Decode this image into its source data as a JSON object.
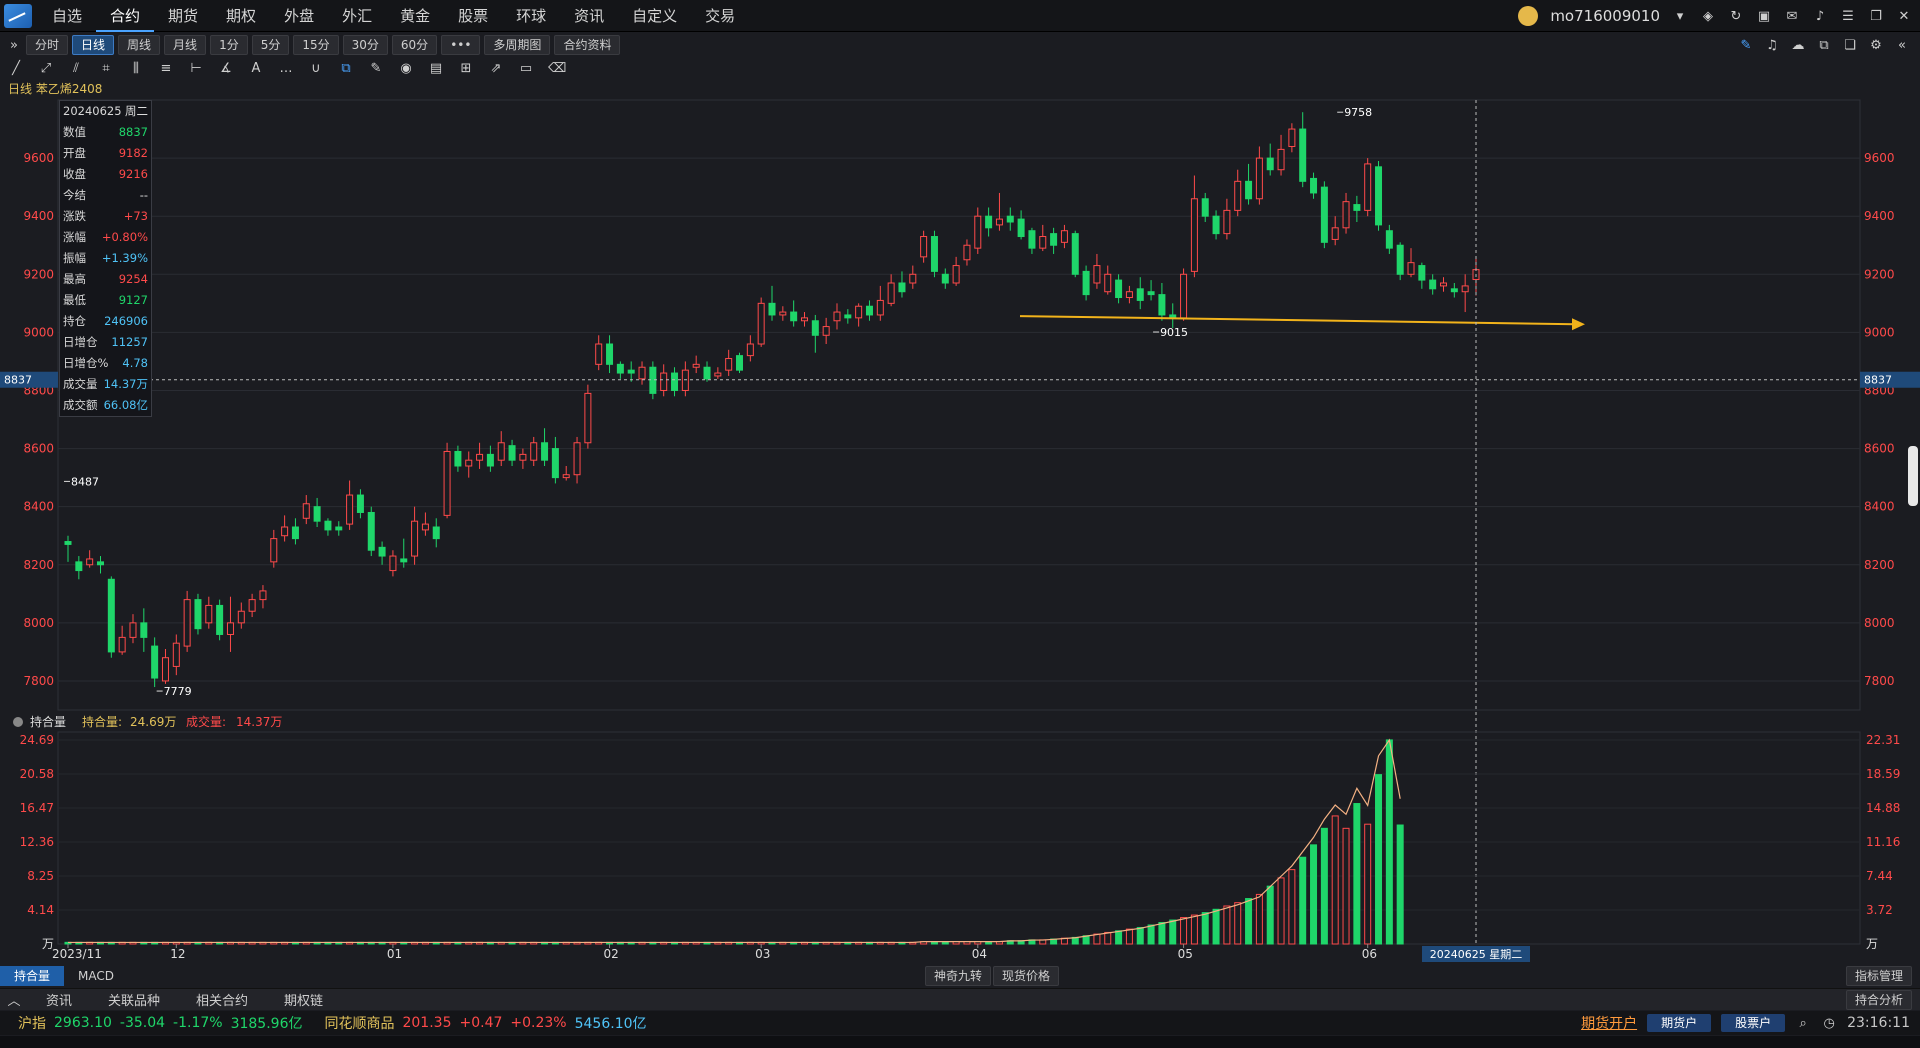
{
  "nav": {
    "items": [
      "自选",
      "合约",
      "期货",
      "期权",
      "外盘",
      "外汇",
      "黄金",
      "股票",
      "环球",
      "资讯",
      "自定义",
      "交易"
    ],
    "active": "合约",
    "user": "mo716009010"
  },
  "periods": {
    "items": [
      "分时",
      "日线",
      "周线",
      "月线",
      "1分",
      "5分",
      "15分",
      "30分",
      "60分",
      "•••",
      "多周期图",
      "合约资料"
    ],
    "active": "日线"
  },
  "title": "日线 苯乙烯2408",
  "info": {
    "rows": [
      {
        "k": "20240625",
        "v": "周二",
        "c": "white"
      },
      {
        "k": "数值",
        "v": "8837",
        "c": "green"
      },
      {
        "k": "开盘",
        "v": "9182",
        "c": "red"
      },
      {
        "k": "收盘",
        "v": "9216",
        "c": "red"
      },
      {
        "k": "今结",
        "v": "--",
        "c": "white"
      },
      {
        "k": "涨跌",
        "v": "+73",
        "c": "red"
      },
      {
        "k": "涨幅",
        "v": "+0.80%",
        "c": "red"
      },
      {
        "k": "振幅",
        "v": "+1.39%",
        "c": "cyan"
      },
      {
        "k": "最高",
        "v": "9254",
        "c": "red"
      },
      {
        "k": "最低",
        "v": "9127",
        "c": "green"
      },
      {
        "k": "持仓",
        "v": "246906",
        "c": "cyan"
      },
      {
        "k": "日增仓",
        "v": "11257",
        "c": "cyan"
      },
      {
        "k": "日增仓%",
        "v": "4.78",
        "c": "cyan"
      },
      {
        "k": "成交量",
        "v": "14.37万",
        "c": "cyan"
      },
      {
        "k": "成交额",
        "v": "66.08亿",
        "c": "cyan"
      }
    ]
  },
  "price_axis": {
    "ticks": [
      "9600",
      "9400",
      "9200",
      "9000",
      "8800",
      "8600",
      "8400",
      "8200",
      "8000",
      "7800"
    ],
    "crosshair_value": "8837"
  },
  "annotations": {
    "high": "9758",
    "low": "7779",
    "mark1": "8487",
    "mark2": "9015"
  },
  "volume_panel": {
    "label": "持合量",
    "oi_label": "持合量:",
    "oi_value": "24.69万",
    "vol_label": "成交量:",
    "vol_value": "14.37万",
    "left_ticks": [
      "24.69",
      "20.58",
      "16.47",
      "12.36",
      "8.25",
      "4.14",
      "万"
    ],
    "right_ticks": [
      "22.31",
      "18.59",
      "14.88",
      "11.16",
      "7.44",
      "3.72",
      "万"
    ]
  },
  "time_axis": {
    "labels": [
      "2023/11",
      "12",
      "01",
      "02",
      "03",
      "04",
      "05",
      "06"
    ],
    "cursor_label": "20240625 星期二"
  },
  "indicator_tabs": {
    "items": [
      "持合量",
      "MACD"
    ],
    "active": "持合量",
    "center": [
      "神奇九转",
      "现货价格"
    ],
    "right": "指标管理"
  },
  "bottom_tabs": {
    "items": [
      "资讯",
      "关联品种",
      "相关合约",
      "期权链"
    ],
    "right": "持合分析"
  },
  "status": {
    "idx1_name": "沪指",
    "idx1_val": "2963.10",
    "idx1_chg": "-35.04",
    "idx1_pct": "-1.17%",
    "idx1_amt": "3185.96亿",
    "idx2_name": "同花顺商品",
    "idx2_val": "201.35",
    "idx2_chg": "+0.47",
    "idx2_pct": "+0.23%",
    "idx2_amt": "5456.10亿",
    "open_acct": "期货开户",
    "btn1": "期货户",
    "btn2": "股票户",
    "time": "23:16:11"
  },
  "chart_data": {
    "type": "candlestick",
    "title": "苯乙烯2408",
    "ylim": [
      7700,
      9800
    ],
    "candles": [
      [
        8280,
        8270,
        8300,
        8210
      ],
      [
        8210,
        8180,
        8230,
        8150
      ],
      [
        8200,
        8220,
        8250,
        8190
      ],
      [
        8210,
        8200,
        8230,
        8170
      ],
      [
        8150,
        7900,
        8160,
        7880
      ],
      [
        7900,
        7950,
        7990,
        7890
      ],
      [
        7950,
        8000,
        8030,
        7930
      ],
      [
        8000,
        7950,
        8050,
        7900
      ],
      [
        7920,
        7810,
        7950,
        7779
      ],
      [
        7800,
        7880,
        7910,
        7790
      ],
      [
        7850,
        7930,
        7960,
        7820
      ],
      [
        7920,
        8080,
        8110,
        7900
      ],
      [
        8080,
        7980,
        8100,
        7960
      ],
      [
        8000,
        8060,
        8090,
        7980
      ],
      [
        8060,
        7960,
        8080,
        7940
      ],
      [
        7960,
        8000,
        8090,
        7900
      ],
      [
        8000,
        8040,
        8070,
        7980
      ],
      [
        8040,
        8080,
        8100,
        8020
      ],
      [
        8080,
        8110,
        8130,
        8050
      ],
      [
        8210,
        8290,
        8320,
        8190
      ],
      [
        8300,
        8330,
        8370,
        8280
      ],
      [
        8330,
        8290,
        8360,
        8270
      ],
      [
        8360,
        8410,
        8440,
        8340
      ],
      [
        8400,
        8350,
        8430,
        8330
      ],
      [
        8350,
        8320,
        8360,
        8300
      ],
      [
        8330,
        8320,
        8350,
        8300
      ],
      [
        8340,
        8440,
        8490,
        8320
      ],
      [
        8440,
        8380,
        8460,
        8360
      ],
      [
        8380,
        8250,
        8400,
        8230
      ],
      [
        8260,
        8230,
        8280,
        8200
      ],
      [
        8180,
        8230,
        8250,
        8160
      ],
      [
        8220,
        8210,
        8290,
        8190
      ],
      [
        8230,
        8350,
        8400,
        8200
      ],
      [
        8320,
        8340,
        8380,
        8300
      ],
      [
        8330,
        8290,
        8360,
        8260
      ],
      [
        8370,
        8590,
        8620,
        8360
      ],
      [
        8590,
        8540,
        8610,
        8520
      ],
      [
        8540,
        8560,
        8590,
        8500
      ],
      [
        8560,
        8580,
        8620,
        8530
      ],
      [
        8580,
        8540,
        8610,
        8520
      ],
      [
        8560,
        8620,
        8660,
        8540
      ],
      [
        8610,
        8560,
        8630,
        8540
      ],
      [
        8560,
        8580,
        8600,
        8530
      ],
      [
        8560,
        8620,
        8640,
        8540
      ],
      [
        8620,
        8560,
        8670,
        8540
      ],
      [
        8600,
        8500,
        8640,
        8480
      ],
      [
        8500,
        8510,
        8540,
        8490
      ],
      [
        8510,
        8620,
        8640,
        8480
      ],
      [
        8620,
        8790,
        8820,
        8600
      ],
      [
        8890,
        8960,
        8990,
        8870
      ],
      [
        8960,
        8890,
        8990,
        8860
      ],
      [
        8890,
        8860,
        8900,
        8840
      ],
      [
        8870,
        8860,
        8900,
        8830
      ],
      [
        8840,
        8880,
        8900,
        8820
      ],
      [
        8880,
        8790,
        8900,
        8770
      ],
      [
        8800,
        8860,
        8890,
        8780
      ],
      [
        8860,
        8800,
        8880,
        8780
      ],
      [
        8800,
        8870,
        8900,
        8780
      ],
      [
        8880,
        8890,
        8920,
        8860
      ],
      [
        8880,
        8840,
        8900,
        8830
      ],
      [
        8850,
        8860,
        8880,
        8840
      ],
      [
        8870,
        8910,
        8940,
        8850
      ],
      [
        8920,
        8870,
        8930,
        8860
      ],
      [
        8920,
        8960,
        8990,
        8900
      ],
      [
        8960,
        9100,
        9120,
        8950
      ],
      [
        9100,
        9060,
        9160,
        9040
      ],
      [
        9060,
        9070,
        9090,
        9040
      ],
      [
        9070,
        9040,
        9110,
        9020
      ],
      [
        9040,
        9050,
        9070,
        9020
      ],
      [
        9040,
        8990,
        9060,
        8930
      ],
      [
        8990,
        9020,
        9050,
        8960
      ],
      [
        9040,
        9070,
        9100,
        9010
      ],
      [
        9060,
        9050,
        9080,
        9030
      ],
      [
        9050,
        9090,
        9100,
        9020
      ],
      [
        9090,
        9060,
        9110,
        9040
      ],
      [
        9060,
        9110,
        9160,
        9040
      ],
      [
        9100,
        9170,
        9200,
        9090
      ],
      [
        9170,
        9140,
        9210,
        9120
      ],
      [
        9170,
        9200,
        9230,
        9150
      ],
      [
        9260,
        9330,
        9350,
        9240
      ],
      [
        9330,
        9210,
        9350,
        9190
      ],
      [
        9200,
        9170,
        9220,
        9150
      ],
      [
        9170,
        9230,
        9260,
        9160
      ],
      [
        9250,
        9300,
        9320,
        9230
      ],
      [
        9290,
        9400,
        9430,
        9270
      ],
      [
        9400,
        9360,
        9430,
        9330
      ],
      [
        9370,
        9390,
        9480,
        9350
      ],
      [
        9400,
        9380,
        9430,
        9350
      ],
      [
        9390,
        9330,
        9420,
        9320
      ],
      [
        9350,
        9290,
        9360,
        9270
      ],
      [
        9290,
        9330,
        9370,
        9280
      ],
      [
        9340,
        9300,
        9360,
        9270
      ],
      [
        9310,
        9350,
        9370,
        9290
      ],
      [
        9340,
        9200,
        9350,
        9190
      ],
      [
        9210,
        9130,
        9230,
        9110
      ],
      [
        9170,
        9230,
        9270,
        9150
      ],
      [
        9140,
        9200,
        9230,
        9130
      ],
      [
        9180,
        9120,
        9200,
        9100
      ],
      [
        9120,
        9140,
        9160,
        9100
      ],
      [
        9150,
        9110,
        9190,
        9080
      ],
      [
        9140,
        9130,
        9180,
        9110
      ],
      [
        9130,
        9060,
        9170,
        9040
      ],
      [
        9060,
        9050,
        9100,
        9015
      ],
      [
        9050,
        9200,
        9220,
        9040
      ],
      [
        9210,
        9460,
        9540,
        9190
      ],
      [
        9460,
        9400,
        9480,
        9380
      ],
      [
        9400,
        9340,
        9420,
        9320
      ],
      [
        9340,
        9420,
        9460,
        9320
      ],
      [
        9420,
        9520,
        9560,
        9400
      ],
      [
        9520,
        9460,
        9580,
        9440
      ],
      [
        9460,
        9600,
        9640,
        9440
      ],
      [
        9600,
        9560,
        9650,
        9540
      ],
      [
        9560,
        9630,
        9680,
        9540
      ],
      [
        9640,
        9700,
        9720,
        9620
      ],
      [
        9700,
        9520,
        9758,
        9500
      ],
      [
        9530,
        9480,
        9550,
        9460
      ],
      [
        9500,
        9310,
        9520,
        9290
      ],
      [
        9320,
        9360,
        9400,
        9300
      ],
      [
        9360,
        9450,
        9480,
        9340
      ],
      [
        9440,
        9420,
        9470,
        9380
      ],
      [
        9420,
        9580,
        9600,
        9400
      ],
      [
        9570,
        9370,
        9590,
        9350
      ],
      [
        9350,
        9290,
        9370,
        9270
      ],
      [
        9300,
        9200,
        9310,
        9180
      ],
      [
        9200,
        9240,
        9290,
        9190
      ],
      [
        9230,
        9180,
        9240,
        9150
      ],
      [
        9180,
        9150,
        9200,
        9130
      ],
      [
        9160,
        9170,
        9190,
        9140
      ],
      [
        9150,
        9140,
        9170,
        9120
      ],
      [
        9140,
        9160,
        9200,
        9070
      ],
      [
        9182,
        9216,
        9254,
        9127
      ]
    ],
    "volume": [
      0.2,
      0.2,
      0.2,
      0.2,
      0.2,
      0.2,
      0.2,
      0.2,
      0.2,
      0.2,
      0.2,
      0.2,
      0.2,
      0.2,
      0.2,
      0.2,
      0.2,
      0.2,
      0.2,
      0.2,
      0.2,
      0.2,
      0.2,
      0.2,
      0.2,
      0.2,
      0.2,
      0.2,
      0.2,
      0.2,
      0.2,
      0.2,
      0.2,
      0.2,
      0.2,
      0.2,
      0.2,
      0.2,
      0.2,
      0.2,
      0.2,
      0.2,
      0.2,
      0.2,
      0.2,
      0.2,
      0.2,
      0.2,
      0.2,
      0.2,
      0.2,
      0.2,
      0.2,
      0.2,
      0.2,
      0.2,
      0.2,
      0.2,
      0.2,
      0.2,
      0.2,
      0.2,
      0.2,
      0.2,
      0.2,
      0.2,
      0.2,
      0.2,
      0.2,
      0.2,
      0.2,
      0.2,
      0.2,
      0.2,
      0.2,
      0.2,
      0.2,
      0.2,
      0.2,
      0.3,
      0.3,
      0.3,
      0.3,
      0.3,
      0.3,
      0.3,
      0.3,
      0.4,
      0.4,
      0.5,
      0.5,
      0.6,
      0.7,
      0.8,
      1.0,
      1.2,
      1.4,
      1.6,
      1.8,
      2.0,
      2.3,
      2.6,
      2.9,
      3.2,
      3.5,
      3.8,
      4.2,
      4.6,
      5.0,
      5.5,
      6.0,
      7.0,
      8.0,
      9.0,
      10.5,
      12.0,
      14.0,
      15.5,
      14.0,
      17.0,
      14.5,
      20.5,
      24.7,
      14.4
    ]
  }
}
